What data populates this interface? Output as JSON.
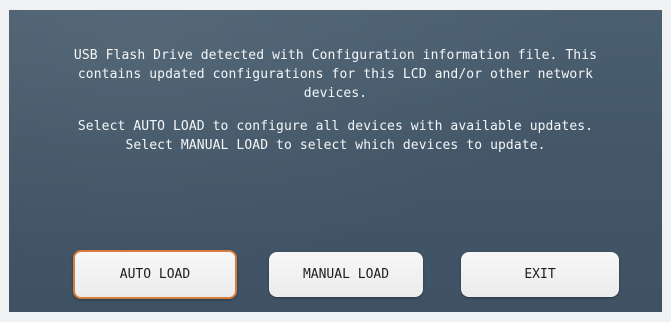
{
  "dialog": {
    "line1": "USB Flash Drive detected with Configuration information file.  This",
    "line2": "contains updated configurations for this LCD and/or other network",
    "line3": "devices.",
    "line4": "Select AUTO LOAD to configure all devices with available updates.",
    "line5": "Select MANUAL LOAD to select which devices to update."
  },
  "buttons": {
    "auto_load": "AUTO LOAD",
    "manual_load": "MANUAL LOAD",
    "exit": "EXIT"
  },
  "colors": {
    "screen_background": "#455a6b",
    "focus_outline": "#d77d3e",
    "button_face": "#f2f2f2"
  }
}
